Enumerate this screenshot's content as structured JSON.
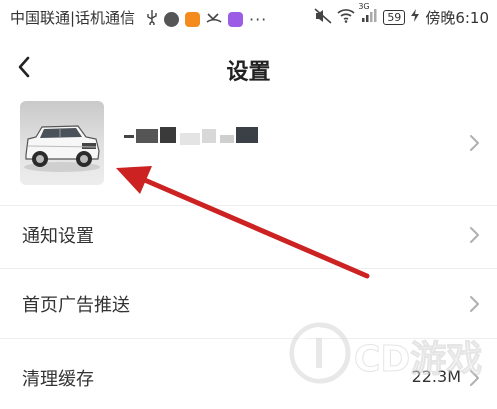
{
  "status_bar": {
    "carrier": "中国联通|话机通信 ",
    "network": "3G",
    "battery": "59",
    "time": "傍晚6:10"
  },
  "header": {
    "title": "设置"
  },
  "settings": {
    "items": [
      {
        "label": "通知设置",
        "value": ""
      },
      {
        "label": "首页广告推送",
        "value": ""
      },
      {
        "label": "清理缓存",
        "value": "22.3M"
      }
    ]
  },
  "icons": {
    "back": "chevron-left-icon",
    "chevron": "chevron-right-icon",
    "avatar": "car-avatar",
    "annotation": "red-arrow"
  },
  "colors": {
    "arrow": "#cc2222",
    "chevron": "#b0b0b0",
    "divider": "#eeeeee"
  }
}
